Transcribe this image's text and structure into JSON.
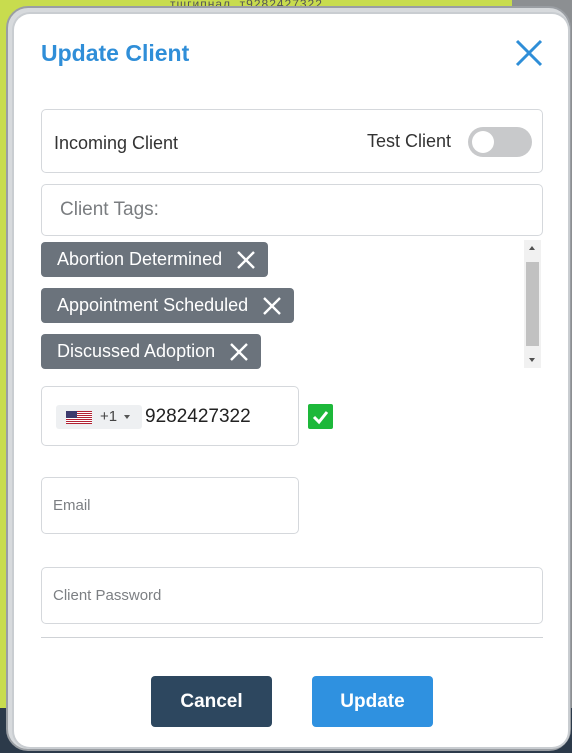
{
  "background": {
    "partial_text": "тшгипнал. т9282427322"
  },
  "modal": {
    "title": "Update Client",
    "close_icon": "close-icon",
    "incoming_label": "Incoming Client",
    "test_client_label": "Test Client",
    "test_client_enabled": false,
    "tags_placeholder": "Client Tags:",
    "tags": [
      {
        "label": "Abortion Determined"
      },
      {
        "label": "Appointment Scheduled"
      },
      {
        "label": "Discussed Adoption"
      }
    ],
    "phone": {
      "country_flag": "us-flag-icon",
      "dial_code": "+1",
      "number": "9282427322",
      "verified": true
    },
    "email_placeholder": "Email",
    "password_placeholder": "Client Password",
    "cancel_label": "Cancel",
    "update_label": "Update"
  },
  "colors": {
    "title": "#2f8ed8",
    "tag_bg": "#6b737c",
    "cancel_bg": "#2d475f",
    "update_bg": "#2f91e0",
    "verified": "#1db83a",
    "toggle_off": "#c8c9cb"
  }
}
